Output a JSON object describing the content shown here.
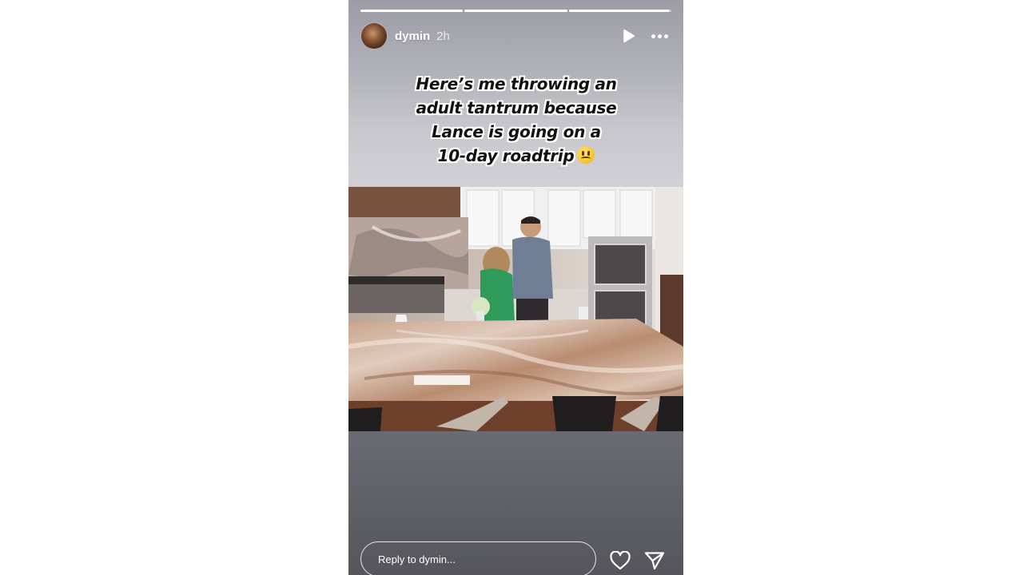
{
  "story": {
    "progress_segments": [
      {
        "fill_fraction": 1.0
      },
      {
        "fill_fraction": 1.0
      },
      {
        "fill_fraction": 0.98
      }
    ],
    "user": {
      "username": "dymin",
      "time_ago": "2h"
    },
    "caption_lines": [
      "Here’s me throwing an",
      "adult tantrum because",
      "Lance is going on a",
      "10-day roadtrip"
    ],
    "caption_emoji": "upside-down-face-emoji",
    "media": {
      "description_icon": "kitchen-photo"
    },
    "reply": {
      "placeholder": "Reply to dymin..."
    },
    "icons": {
      "play": "play-icon",
      "more": "more-options-icon",
      "like": "heart-icon",
      "share": "send-icon"
    }
  }
}
